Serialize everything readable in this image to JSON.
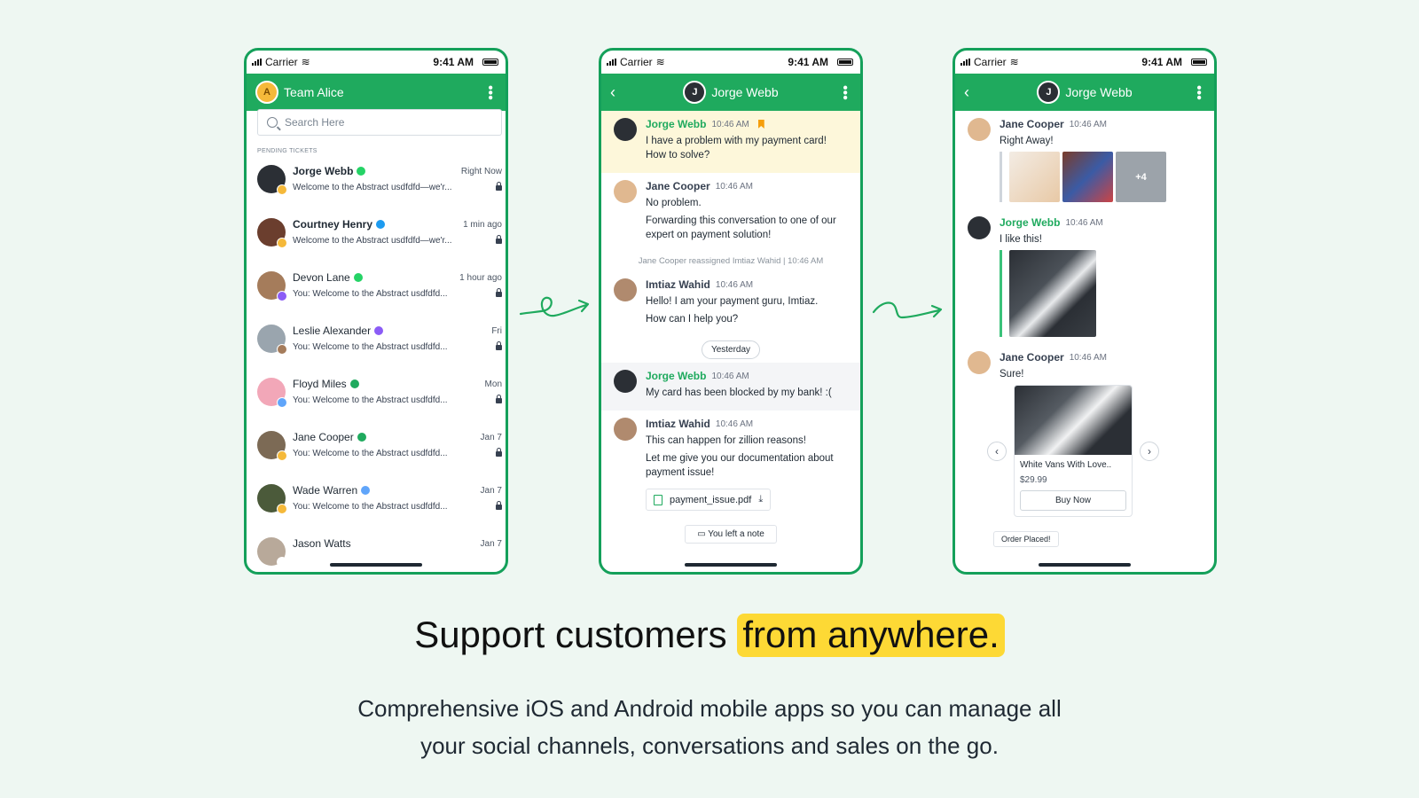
{
  "statusbar": {
    "carrier": "Carrier",
    "time": "9:41 AM"
  },
  "phone1": {
    "title": "Team Alice",
    "search_placeholder": "Search Here",
    "section": "PENDING TICKETS",
    "conversations": [
      {
        "name": "Jorge Webb",
        "when": "Right Now",
        "preview": "Welcome to the Abstract usdfdfd—we'r...",
        "bold": true,
        "avatar_color": "#2b2f35",
        "channel_color": "#f5b93a",
        "badge_color": "#25d366"
      },
      {
        "name": "Courtney Henry",
        "when": "1 min ago",
        "preview": "Welcome to the Abstract usdfdfd—we'r...",
        "bold": true,
        "avatar_color": "#6b3e2e",
        "channel_color": "#f5b93a",
        "badge_color": "#1d9bf0"
      },
      {
        "name": "Devon Lane",
        "when": "1 hour ago",
        "preview": "You: Welcome to the Abstract usdfdfd...",
        "bold": false,
        "avatar_color": "#a57c5b",
        "channel_color": "#8b5cf6",
        "badge_color": "#25d366"
      },
      {
        "name": "Leslie Alexander",
        "when": "Fri",
        "preview": "You: Welcome to the Abstract usdfdfd...",
        "bold": false,
        "avatar_color": "#9aa5ae",
        "channel_color": "#a57c5b",
        "badge_color": "#8b5cf6"
      },
      {
        "name": "Floyd Miles",
        "when": "Mon",
        "preview": "You: Welcome to the Abstract usdfdfd...",
        "bold": false,
        "avatar_color": "#f2a7b8",
        "channel_color": "#60a5fa",
        "badge_color": "#1faa5e"
      },
      {
        "name": "Jane Cooper",
        "when": "Jan 7",
        "preview": "You: Welcome to the Abstract usdfdfd...",
        "bold": false,
        "avatar_color": "#7c6a55",
        "channel_color": "#f5b93a",
        "badge_color": "#1faa5e"
      },
      {
        "name": "Wade Warren",
        "when": "Jan 7",
        "preview": "You: Welcome to the Abstract usdfdfd...",
        "bold": false,
        "avatar_color": "#4b5a3a",
        "channel_color": "#f5b93a",
        "badge_color": "#60a5fa"
      },
      {
        "name": "Jason Watts",
        "when": "Jan 7",
        "preview": "",
        "bold": false,
        "avatar_color": "#b8a99a",
        "channel_color": "#ffffff",
        "badge_color": ""
      }
    ]
  },
  "phone2": {
    "title": "Jorge Webb",
    "m1": {
      "name": "Jorge Webb",
      "time": "10:46 AM",
      "l1": "I have a problem with my payment card!",
      "l2": "How to solve?"
    },
    "m2": {
      "name": "Jane Cooper",
      "time": "10:46 AM",
      "l1": "No problem.",
      "l2": "Forwarding this conversation to one of our",
      "l3": "expert on payment solution!"
    },
    "system": "Jane Cooper reassigned Imtiaz Wahid | 10:46 AM",
    "m3": {
      "name": "Imtiaz Wahid",
      "time": "10:46 AM",
      "l1": "Hello! I am your payment guru, Imtiaz.",
      "l2": "How can I help you?"
    },
    "divider": "Yesterday",
    "m4": {
      "name": "Jorge Webb",
      "time": "10:46 AM",
      "l1": "My card has been blocked by my bank! :("
    },
    "m5": {
      "name": "Imtiaz Wahid",
      "time": "10:46 AM",
      "l1": "This can happen for zillion reasons!",
      "l2": "Let me give you our documentation about",
      "l3": "payment issue!",
      "file": "payment_issue.pdf"
    },
    "note": "You left a note"
  },
  "phone3": {
    "title": "Jorge Webb",
    "m1": {
      "name": "Jane Cooper",
      "time": "10:46 AM",
      "l1": "Right Away!",
      "more": "+4"
    },
    "m2": {
      "name": "Jorge Webb",
      "time": "10:46 AM",
      "l1": "I like this!"
    },
    "m3": {
      "name": "Jane Cooper",
      "time": "10:46 AM",
      "l1": "Sure!"
    },
    "product": {
      "title": "White Vans With Love..",
      "price": "$29.99",
      "cta": "Buy Now"
    },
    "order": "Order Placed!"
  },
  "headline": {
    "before": "Support customers ",
    "highlight": "from anywhere."
  },
  "subtext": {
    "line1": "Comprehensive iOS and Android mobile apps so you can manage all",
    "line2": "your social channels, conversations and sales on the go."
  },
  "colors": {
    "brand_green": "#1faa5e",
    "highlight_yellow": "#fdd935",
    "background": "#eef7f2"
  }
}
